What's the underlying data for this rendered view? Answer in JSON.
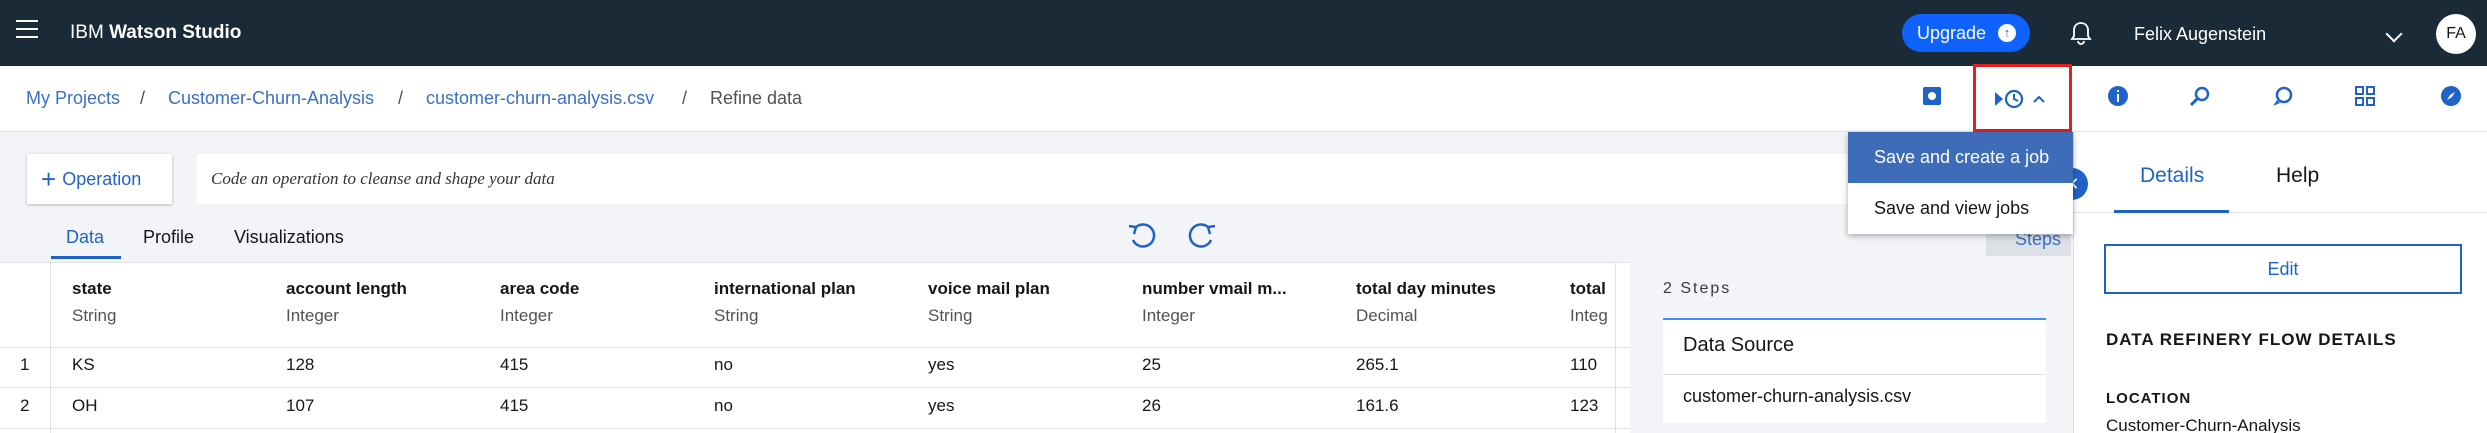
{
  "header": {
    "brand_prefix": "IBM",
    "brand_name": "Watson Studio",
    "upgrade_label": "Upgrade",
    "user_name": "Felix Augenstein",
    "avatar_initials": "FA"
  },
  "breadcrumb": {
    "items": [
      "My Projects",
      "Customer-Churn-Analysis",
      "customer-churn-analysis.csv"
    ],
    "current": "Refine data",
    "separator": "/"
  },
  "toolbar": {
    "operation_label": "Operation",
    "code_placeholder": "Code an operation to cleanse and shape your data"
  },
  "tabs": [
    "Data",
    "Profile",
    "Visualizations"
  ],
  "steps_button_label": "Steps",
  "table": {
    "columns": [
      {
        "name": "state",
        "type": "String"
      },
      {
        "name": "account length",
        "type": "Integer"
      },
      {
        "name": "area code",
        "type": "Integer"
      },
      {
        "name": "international plan",
        "type": "String"
      },
      {
        "name": "voice mail plan",
        "type": "String"
      },
      {
        "name": "number vmail m...",
        "type": "Integer"
      },
      {
        "name": "total day minutes",
        "type": "Decimal"
      },
      {
        "name": "total",
        "type": "Integ"
      }
    ],
    "rows": [
      {
        "num": "1",
        "cells": [
          "KS",
          "128",
          "415",
          "no",
          "yes",
          "25",
          "265.1",
          "110"
        ]
      },
      {
        "num": "2",
        "cells": [
          "OH",
          "107",
          "415",
          "no",
          "yes",
          "26",
          "161.6",
          "123"
        ]
      }
    ]
  },
  "steps_panel": {
    "count_label": "2 Steps",
    "data_source_title": "Data Source",
    "data_source_file": "customer-churn-analysis.csv"
  },
  "jobs_menu": {
    "items": [
      "Save and create a job",
      "Save and view jobs"
    ]
  },
  "right_panel": {
    "tabs": [
      "Details",
      "Help"
    ],
    "edit_label": "Edit",
    "details_heading": "DATA REFINERY FLOW DETAILS",
    "location_heading": "LOCATION",
    "location_value": "Customer-Churn-Analysis"
  },
  "colors": {
    "header_bg": "#1a2a36",
    "accent": "#1f63c9",
    "highlight_box": "#e02020",
    "menu_active": "#3e6cb8"
  },
  "icons": {
    "toolbar": [
      "save-icon",
      "jobs-icon",
      "info-icon",
      "search-icon",
      "chat-icon",
      "grid-icon",
      "compass-icon"
    ]
  }
}
